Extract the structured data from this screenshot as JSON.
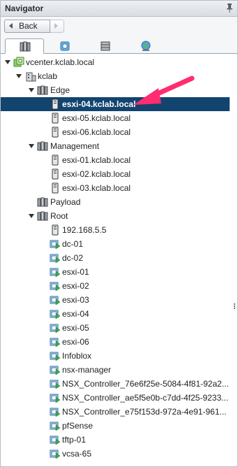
{
  "panel": {
    "title": "Navigator"
  },
  "nav": {
    "back_label": "Back"
  },
  "tabs": [
    {
      "icon": "hosts-clusters-icon",
      "active": true
    },
    {
      "icon": "vms-templates-icon",
      "active": false
    },
    {
      "icon": "storage-icon",
      "active": false
    },
    {
      "icon": "networking-icon",
      "active": false
    }
  ],
  "tree": {
    "vcenter": "vcenter.kclab.local",
    "datacenter": "kclab",
    "edge": {
      "label": "Edge",
      "hosts": [
        "esxi-04.kclab.local",
        "esxi-05.kclab.local",
        "esxi-06.kclab.local"
      ]
    },
    "management": {
      "label": "Management",
      "hosts": [
        "esxi-01.kclab.local",
        "esxi-02.kclab.local",
        "esxi-03.kclab.local"
      ]
    },
    "payload": {
      "label": "Payload"
    },
    "root": {
      "label": "Root",
      "host": "192.168.5.5",
      "vms": [
        "dc-01",
        "dc-02",
        "esxi-01",
        "esxi-02",
        "esxi-03",
        "esxi-04",
        "esxi-05",
        "esxi-06",
        "Infoblox",
        "nsx-manager",
        "NSX_Controller_76e6f25e-5084-4f81-92a2...",
        "NSX_Controller_ae5f5e0b-c7dd-4f25-9233...",
        "NSX_Controller_e75f153d-972a-4e91-961...",
        "pfSense",
        "tftp-01",
        "vcsa-65"
      ]
    }
  },
  "selected": "esxi-04.kclab.local",
  "colors": {
    "selection": "#12446f",
    "annotation_arrow": "#ff2d6f",
    "vm_green": "#3aa84a"
  }
}
